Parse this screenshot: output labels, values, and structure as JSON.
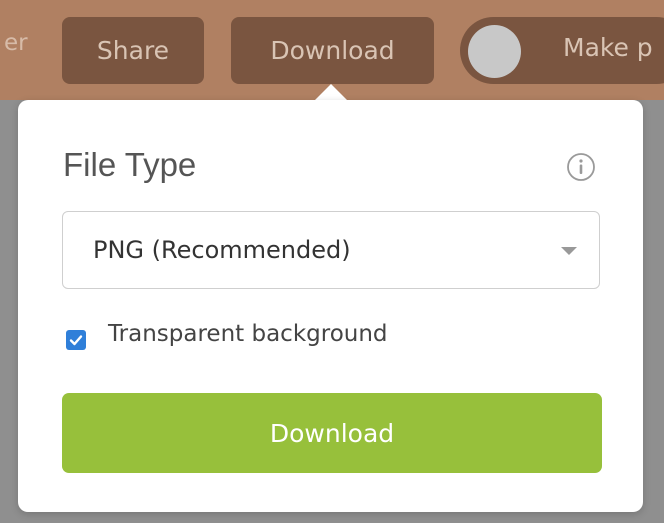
{
  "toolbar": {
    "cutoff_text": "er",
    "share_label": "Share",
    "download_label": "Download",
    "toggle_label": "Make p"
  },
  "popover": {
    "title": "File Type",
    "info_icon": "info-icon",
    "file_type_select": {
      "value": "PNG (Recommended)"
    },
    "transparent_background": {
      "label": "Transparent background",
      "checked": true
    },
    "download_button_label": "Download"
  },
  "colors": {
    "toolbar_bg": "#b08062",
    "toolbar_button_bg": "#7a5540",
    "checkbox_accent": "#2f7fd9",
    "download_button_bg": "#97c03b"
  }
}
